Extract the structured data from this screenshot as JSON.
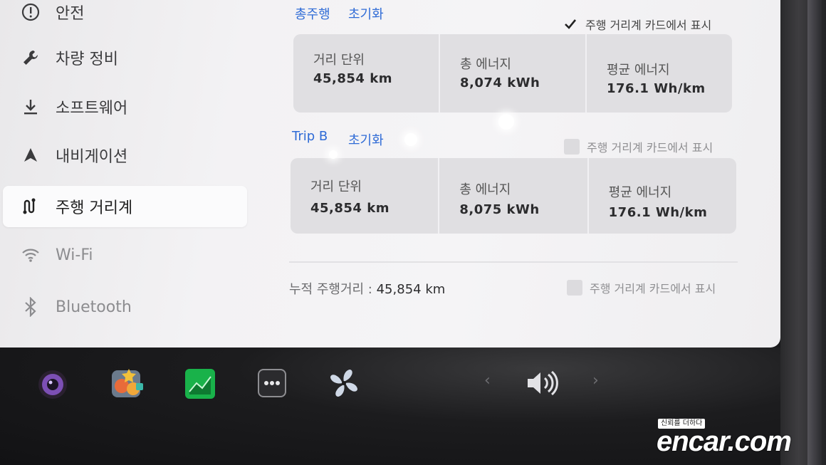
{
  "sidebar": {
    "items": [
      {
        "label": "안전",
        "icon": "info-circle-icon"
      },
      {
        "label": "차량 정비",
        "icon": "wrench-icon"
      },
      {
        "label": "소프트웨어",
        "icon": "download-icon"
      },
      {
        "label": "내비게이션",
        "icon": "navigation-arrow-icon"
      },
      {
        "label": "주행 거리계",
        "icon": "trip-route-icon",
        "active": true
      },
      {
        "label": "Wi-Fi",
        "icon": "wifi-icon"
      },
      {
        "label": "Bluetooth",
        "icon": "bluetooth-icon"
      }
    ]
  },
  "trip_a": {
    "title": "총주행",
    "reset": "초기화",
    "show_label": "주행 거리계 카드에서 표시",
    "show_checked": true,
    "stats": [
      {
        "label": "거리 단위",
        "value": "45,854 km"
      },
      {
        "label": "총 에너지",
        "value": "8,074 kWh"
      },
      {
        "label": "평균 에너지",
        "value": "176.1 Wh/km"
      }
    ]
  },
  "trip_b": {
    "title": "Trip B",
    "reset": "초기화",
    "show_label": "주행 거리계 카드에서 표시",
    "show_checked": false,
    "stats": [
      {
        "label": "거리 단위",
        "value": "45,854 km"
      },
      {
        "label": "총 에너지",
        "value": "8,075 kWh"
      },
      {
        "label": "평균 에너지",
        "value": "176.1 Wh/km"
      }
    ]
  },
  "odometer": {
    "label": "누적 주행거리 :",
    "value": "45,854 km",
    "show_label": "주행 거리계 카드에서 표시",
    "show_checked": false
  },
  "taskbar": {
    "apps": [
      "camera-app-icon",
      "toybox-app-icon",
      "energy-app-icon",
      "more-apps-icon",
      "fan-icon"
    ],
    "volume_icon": "volume-icon"
  },
  "watermark": {
    "tagline": "신뢰를 더하다",
    "logo": "encar.com"
  },
  "colors": {
    "accent": "#2f6bd6",
    "screen_bg": "#f3f2f4",
    "card_bg": "#e0dfe2"
  }
}
